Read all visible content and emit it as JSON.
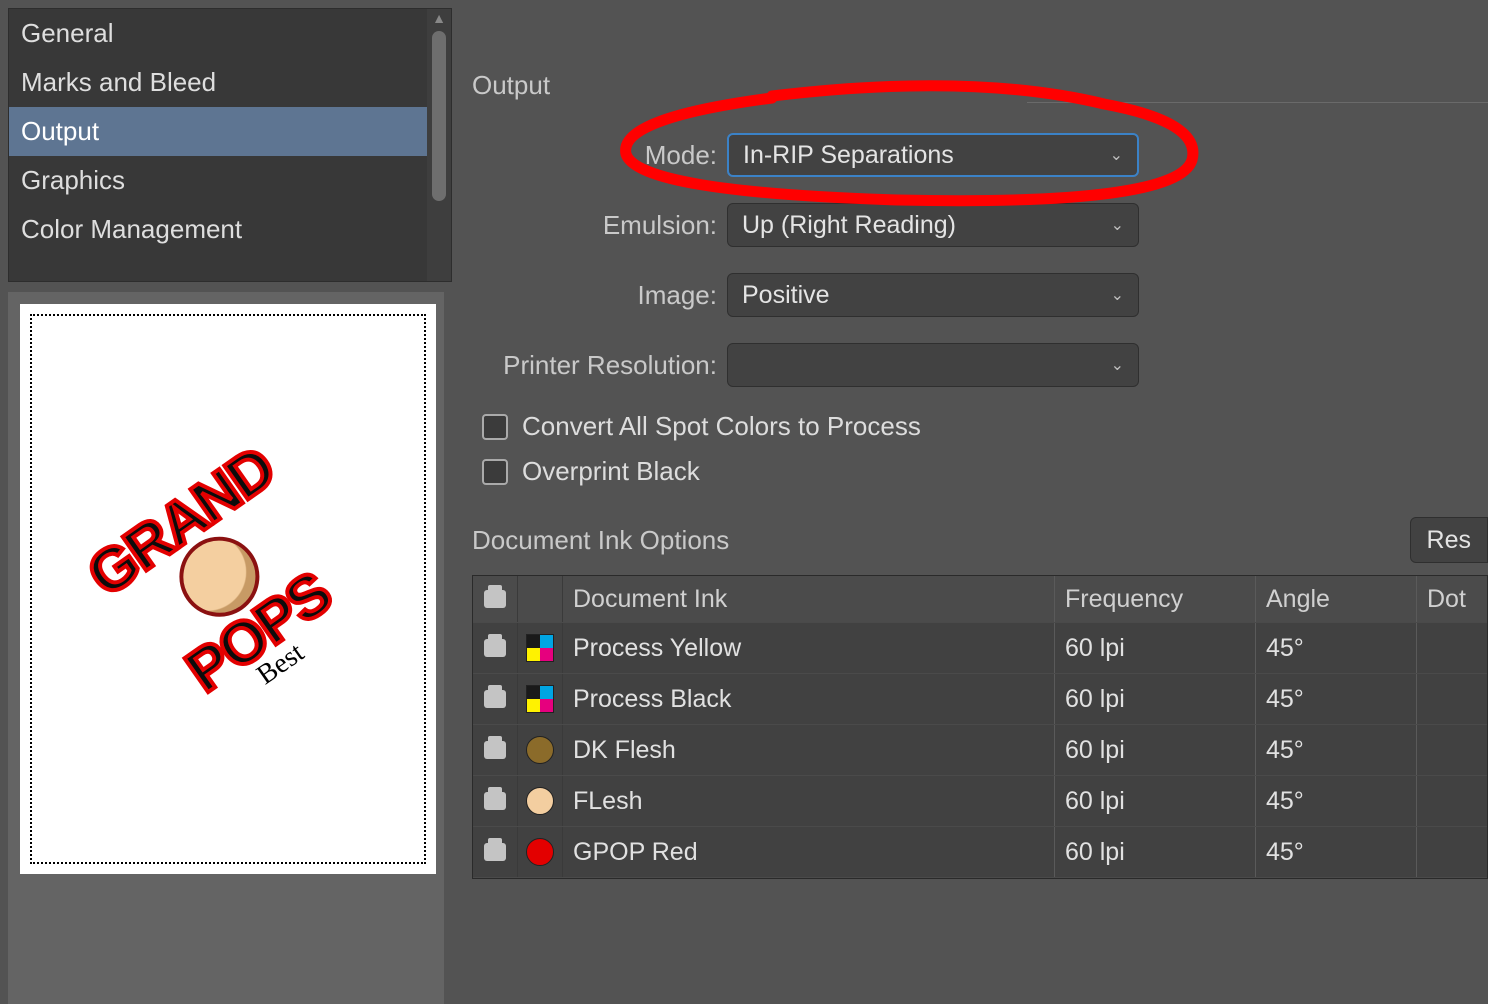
{
  "sidebar": {
    "items": [
      "General",
      "Marks and Bleed",
      "Output",
      "Graphics",
      "Color Management"
    ],
    "selected_index": 2
  },
  "output": {
    "section_title": "Output",
    "mode_label": "Mode:",
    "mode_value": "In-RIP Separations",
    "emulsion_label": "Emulsion:",
    "emulsion_value": "Up (Right Reading)",
    "image_label": "Image:",
    "image_value": "Positive",
    "printer_res_label": "Printer Resolution:",
    "printer_res_value": "",
    "convert_spot_label": "Convert All Spot Colors to Process",
    "overprint_black_label": "Overprint Black",
    "ink_options_title": "Document Ink Options",
    "reset_label": "Res",
    "columns": {
      "ink": "Document Ink",
      "freq": "Frequency",
      "angle": "Angle",
      "dot": "Dot"
    },
    "inks": [
      {
        "swatch": "yellow",
        "name": "Process Yellow",
        "freq": "60 lpi",
        "angle": "45°"
      },
      {
        "swatch": "black",
        "name": "Process Black",
        "freq": "60 lpi",
        "angle": "45°"
      },
      {
        "swatch": "dk",
        "name": "DK Flesh",
        "freq": "60 lpi",
        "angle": "45°"
      },
      {
        "swatch": "flesh",
        "name": "FLesh",
        "freq": "60 lpi",
        "angle": "45°"
      },
      {
        "swatch": "red",
        "name": "GPOP Red",
        "freq": "60 lpi",
        "angle": "45°"
      }
    ]
  },
  "preview": {
    "logo_line1": "GRAND",
    "logo_line2": "POPS",
    "logo_tag": "Best"
  }
}
